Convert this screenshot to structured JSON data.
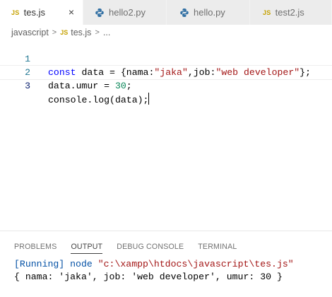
{
  "tabs": [
    {
      "label": "tes.js",
      "icon": "js-file-icon",
      "badge": "JS",
      "active": true,
      "close": "×"
    },
    {
      "label": "hello2.py",
      "icon": "python-file-icon",
      "active": false
    },
    {
      "label": "hello.py",
      "icon": "python-file-icon",
      "active": false
    },
    {
      "label": "test2.js",
      "icon": "js-file-icon",
      "badge": "JS",
      "active": false
    }
  ],
  "breadcrumb": {
    "folder": "javascript",
    "sep": ">",
    "file_badge": "JS",
    "file": "tes.js",
    "more": "..."
  },
  "editor": {
    "lines": [
      {
        "number": "1",
        "tokens": [
          {
            "t": "const",
            "c": "kw"
          },
          {
            "t": " data = {nama:",
            "c": ""
          },
          {
            "t": "\"jaka\"",
            "c": "str"
          },
          {
            "t": ",job:",
            "c": ""
          },
          {
            "t": "\"web developer\"",
            "c": "str"
          },
          {
            "t": "};",
            "c": ""
          }
        ]
      },
      {
        "number": "2",
        "tokens": [
          {
            "t": "data.umur = ",
            "c": ""
          },
          {
            "t": "30",
            "c": "num"
          },
          {
            "t": ";",
            "c": ""
          }
        ]
      },
      {
        "number": "3",
        "tokens": [
          {
            "t": "console.log(data);",
            "c": ""
          }
        ]
      }
    ]
  },
  "panel": {
    "tabs": [
      "PROBLEMS",
      "OUTPUT",
      "DEBUG CONSOLE",
      "TERMINAL"
    ],
    "active_tab": "OUTPUT",
    "output": {
      "run_tag": "[Running]",
      "cmd_prefix": " node ",
      "cmd_path": "\"c:\\xampp\\htdocs\\javascript\\tes.js\"",
      "result": "{ nama: 'jaka', job: 'web developer', umur: 30 }"
    }
  },
  "colors": {
    "keyword": "#0000ff",
    "string": "#a31515",
    "number": "#098658",
    "line_number": "#237893",
    "js_badge": "#c5a100"
  }
}
